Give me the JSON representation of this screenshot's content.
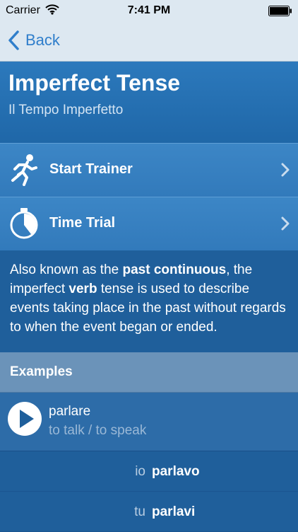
{
  "status_bar": {
    "carrier": "Carrier",
    "time": "7:41 PM"
  },
  "nav": {
    "back_label": "Back"
  },
  "header": {
    "title": "Imperfect Tense",
    "subtitle": "Il Tempo Imperfetto"
  },
  "menu": [
    {
      "label": "Start Trainer",
      "icon": "runner-icon"
    },
    {
      "label": "Time Trial",
      "icon": "stopwatch-icon"
    }
  ],
  "description": {
    "part1": "Also known as the ",
    "bold1": "past continuous",
    "part2": ", the imperfect ",
    "bold2": "verb",
    "part3": " tense is used to describe events taking place in the past without regards to when the event began or ended."
  },
  "examples": {
    "header": "Examples",
    "verb": "parlare",
    "meaning": "to talk / to speak",
    "conjugations": [
      {
        "pronoun": "io",
        "form": "parlavo"
      },
      {
        "pronoun": "tu",
        "form": "parlavi"
      }
    ]
  },
  "colors": {
    "accent": "#2f7ecb",
    "header_bg": "#2a74b6",
    "body_bg": "#1f5f9b",
    "section_bg": "#6b93b9"
  }
}
